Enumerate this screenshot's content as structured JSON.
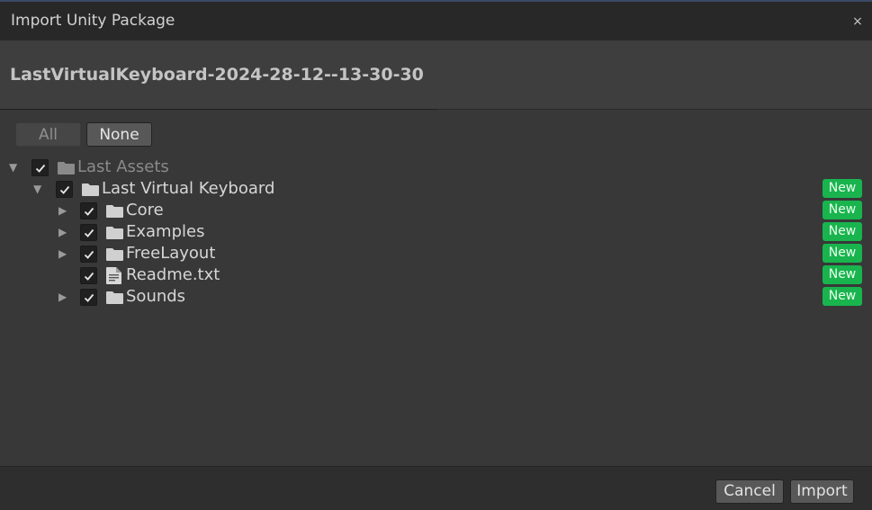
{
  "window": {
    "title": "Import Unity Package",
    "close_glyph": "×"
  },
  "package": {
    "name": "LastVirtualKeyboard-2024-28-12--13-30-30"
  },
  "selection": {
    "all_label": "All",
    "none_label": "None"
  },
  "tree": {
    "items": [
      {
        "label": "Last Assets",
        "type": "folder",
        "checked": true,
        "expanded": true,
        "badge": ""
      },
      {
        "label": "Last Virtual Keyboard",
        "type": "folder",
        "checked": true,
        "expanded": true,
        "badge": "New"
      },
      {
        "label": "Core",
        "type": "folder",
        "checked": true,
        "expanded": false,
        "badge": "New"
      },
      {
        "label": "Examples",
        "type": "folder",
        "checked": true,
        "expanded": false,
        "badge": "New"
      },
      {
        "label": "FreeLayout",
        "type": "folder",
        "checked": true,
        "expanded": false,
        "badge": "New"
      },
      {
        "label": "Readme.txt",
        "type": "file",
        "checked": true,
        "expanded": false,
        "badge": "New"
      },
      {
        "label": "Sounds",
        "type": "folder",
        "checked": true,
        "expanded": false,
        "badge": "New"
      }
    ]
  },
  "footer": {
    "cancel_label": "Cancel",
    "import_label": "Import"
  },
  "colors": {
    "new_badge": "#19b44e",
    "background": "#383838",
    "titlebar": "#282828"
  }
}
